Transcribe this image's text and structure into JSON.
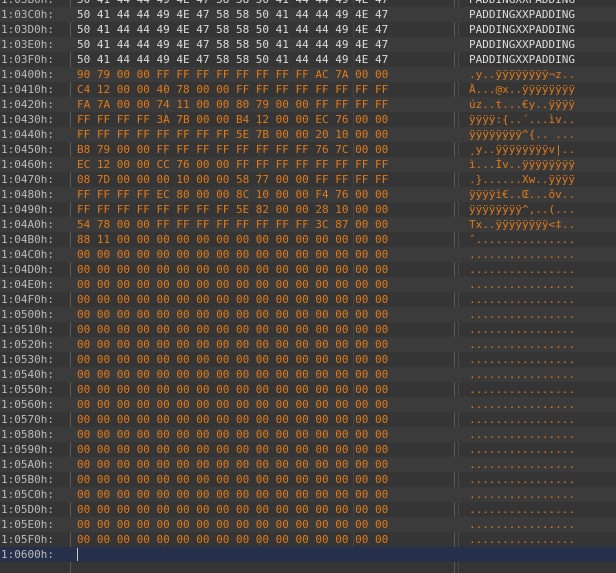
{
  "hex_view": {
    "rows": [
      {
        "address": "1:03B0h:",
        "hex": "50 41 44 44 49 4E 47 58 58 50 41 44 44 49 4E 47",
        "ascii": "PADDINGXXPADDING",
        "style": "plain"
      },
      {
        "address": "1:03C0h:",
        "hex": "50 41 44 44 49 4E 47 58 58 50 41 44 44 49 4E 47",
        "ascii": "PADDINGXXPADDING",
        "style": "plain"
      },
      {
        "address": "1:03D0h:",
        "hex": "50 41 44 44 49 4E 47 58 58 50 41 44 44 49 4E 47",
        "ascii": "PADDINGXXPADDING",
        "style": "plain"
      },
      {
        "address": "1:03E0h:",
        "hex": "50 41 44 44 49 4E 47 58 58 50 41 44 44 49 4E 47",
        "ascii": "PADDINGXXPADDING",
        "style": "plain"
      },
      {
        "address": "1:03F0h:",
        "hex": "50 41 44 44 49 4E 47 58 58 50 41 44 44 49 4E 47",
        "ascii": "PADDINGXXPADDING",
        "style": "plain"
      },
      {
        "address": "1:0400h:",
        "hex": "90 79 00 00 FF FF FF FF FF FF FF FF AC 7A 00 00",
        "ascii": ".y..ÿÿÿÿÿÿÿÿ¬z..",
        "style": "data"
      },
      {
        "address": "1:0410h:",
        "hex": "C4 12 00 00 40 78 00 00 FF FF FF FF FF FF FF FF",
        "ascii": "Ä...@x..ÿÿÿÿÿÿÿÿ",
        "style": "data"
      },
      {
        "address": "1:0420h:",
        "hex": "FA 7A 00 00 74 11 00 00 80 79 00 00 FF FF FF FF",
        "ascii": "úz..t...€y..ÿÿÿÿ",
        "style": "data"
      },
      {
        "address": "1:0430h:",
        "hex": "FF FF FF FF 3A 7B 00 00 B4 12 00 00 EC 76 00 00",
        "ascii": "ÿÿÿÿ:{..´...ìv..",
        "style": "data"
      },
      {
        "address": "1:0440h:",
        "hex": "FF FF FF FF FF FF FF FF 5E 7B 00 00 20 10 00 00",
        "ascii": "ÿÿÿÿÿÿÿÿ^{.. ...",
        "style": "data"
      },
      {
        "address": "1:0450h:",
        "hex": "B8 79 00 00 FF FF FF FF FF FF FF FF 76 7C 00 00",
        "ascii": "¸y..ÿÿÿÿÿÿÿÿv|..",
        "style": "data"
      },
      {
        "address": "1:0460h:",
        "hex": "EC 12 00 00 CC 76 00 00 FF FF FF FF FF FF FF FF",
        "ascii": "ì...Ìv..ÿÿÿÿÿÿÿÿ",
        "style": "data"
      },
      {
        "address": "1:0470h:",
        "hex": "08 7D 00 00 00 10 00 00 58 77 00 00 FF FF FF FF",
        "ascii": ".}......Xw..ÿÿÿÿ",
        "style": "data"
      },
      {
        "address": "1:0480h:",
        "hex": "FF FF FF FF EC 80 00 00 8C 10 00 00 F4 76 00 00",
        "ascii": "ÿÿÿÿì€..Œ...ôv..",
        "style": "data"
      },
      {
        "address": "1:0490h:",
        "hex": "FF FF FF FF FF FF FF FF 5E 82 00 00 28 10 00 00",
        "ascii": "ÿÿÿÿÿÿÿÿ^‚..(...",
        "style": "data"
      },
      {
        "address": "1:04A0h:",
        "hex": "54 78 00 00 FF FF FF FF FF FF FF FF 3C 87 00 00",
        "ascii": "Tx..ÿÿÿÿÿÿÿÿ<‡..",
        "style": "data"
      },
      {
        "address": "1:04B0h:",
        "hex": "88 11 00 00 00 00 00 00 00 00 00 00 00 00 00 00",
        "ascii": "ˆ...............",
        "style": "data"
      },
      {
        "address": "1:04C0h:",
        "hex": "00 00 00 00 00 00 00 00 00 00 00 00 00 00 00 00",
        "ascii": "................",
        "style": "data"
      },
      {
        "address": "1:04D0h:",
        "hex": "00 00 00 00 00 00 00 00 00 00 00 00 00 00 00 00",
        "ascii": "................",
        "style": "data"
      },
      {
        "address": "1:04E0h:",
        "hex": "00 00 00 00 00 00 00 00 00 00 00 00 00 00 00 00",
        "ascii": "................",
        "style": "data"
      },
      {
        "address": "1:04F0h:",
        "hex": "00 00 00 00 00 00 00 00 00 00 00 00 00 00 00 00",
        "ascii": "................",
        "style": "data"
      },
      {
        "address": "1:0500h:",
        "hex": "00 00 00 00 00 00 00 00 00 00 00 00 00 00 00 00",
        "ascii": "................",
        "style": "data"
      },
      {
        "address": "1:0510h:",
        "hex": "00 00 00 00 00 00 00 00 00 00 00 00 00 00 00 00",
        "ascii": "................",
        "style": "data"
      },
      {
        "address": "1:0520h:",
        "hex": "00 00 00 00 00 00 00 00 00 00 00 00 00 00 00 00",
        "ascii": "................",
        "style": "data"
      },
      {
        "address": "1:0530h:",
        "hex": "00 00 00 00 00 00 00 00 00 00 00 00 00 00 00 00",
        "ascii": "................",
        "style": "data"
      },
      {
        "address": "1:0540h:",
        "hex": "00 00 00 00 00 00 00 00 00 00 00 00 00 00 00 00",
        "ascii": "................",
        "style": "data"
      },
      {
        "address": "1:0550h:",
        "hex": "00 00 00 00 00 00 00 00 00 00 00 00 00 00 00 00",
        "ascii": "................",
        "style": "data"
      },
      {
        "address": "1:0560h:",
        "hex": "00 00 00 00 00 00 00 00 00 00 00 00 00 00 00 00",
        "ascii": "................",
        "style": "data"
      },
      {
        "address": "1:0570h:",
        "hex": "00 00 00 00 00 00 00 00 00 00 00 00 00 00 00 00",
        "ascii": "................",
        "style": "data"
      },
      {
        "address": "1:0580h:",
        "hex": "00 00 00 00 00 00 00 00 00 00 00 00 00 00 00 00",
        "ascii": "................",
        "style": "data"
      },
      {
        "address": "1:0590h:",
        "hex": "00 00 00 00 00 00 00 00 00 00 00 00 00 00 00 00",
        "ascii": "................",
        "style": "data"
      },
      {
        "address": "1:05A0h:",
        "hex": "00 00 00 00 00 00 00 00 00 00 00 00 00 00 00 00",
        "ascii": "................",
        "style": "data"
      },
      {
        "address": "1:05B0h:",
        "hex": "00 00 00 00 00 00 00 00 00 00 00 00 00 00 00 00",
        "ascii": "................",
        "style": "data"
      },
      {
        "address": "1:05C0h:",
        "hex": "00 00 00 00 00 00 00 00 00 00 00 00 00 00 00 00",
        "ascii": "................",
        "style": "data"
      },
      {
        "address": "1:05D0h:",
        "hex": "00 00 00 00 00 00 00 00 00 00 00 00 00 00 00 00",
        "ascii": "................",
        "style": "data"
      },
      {
        "address": "1:05E0h:",
        "hex": "00 00 00 00 00 00 00 00 00 00 00 00 00 00 00 00",
        "ascii": "................",
        "style": "data"
      },
      {
        "address": "1:05F0h:",
        "hex": "00 00 00 00 00 00 00 00 00 00 00 00 00 00 00 00",
        "ascii": "................",
        "style": "data"
      },
      {
        "address": "1:0600h:",
        "hex": "",
        "ascii": "",
        "style": "cursor"
      }
    ]
  },
  "colors": {
    "background": "#353535",
    "address_text": "#b9b9b9",
    "plain_text": "#dcdcdc",
    "data_text": "#e07a1a",
    "cursor_row": "#26304a"
  }
}
